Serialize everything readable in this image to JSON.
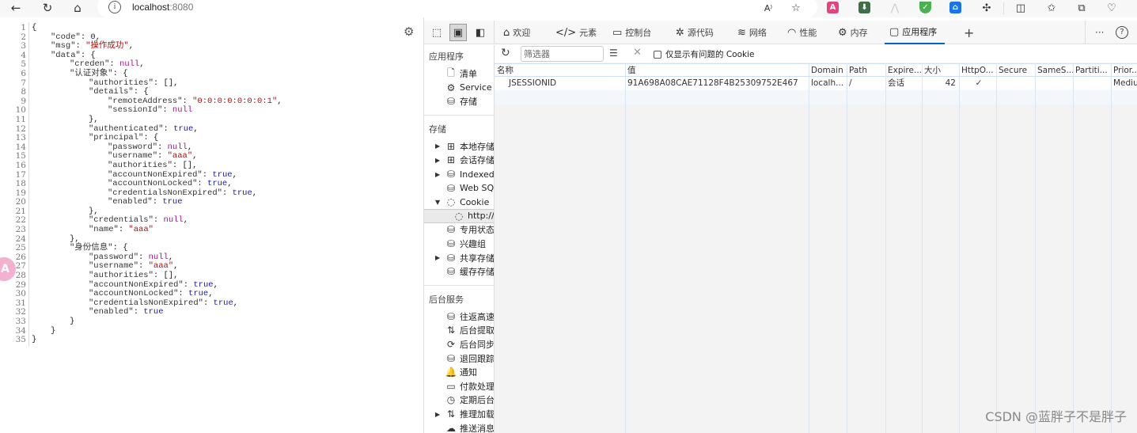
{
  "browser": {
    "url_host": "localhost",
    "url_port": ":8080",
    "icons": [
      "back-icon",
      "refresh-icon",
      "home-icon",
      "info-icon",
      "read-aloud-icon",
      "favorite-star-icon",
      "translate-extension-icon",
      "download-extension-icon",
      "extension-icon",
      "shield-extension-icon",
      "extension-icon",
      "puzzle-extensions-icon",
      "split-screen-icon",
      "favorites-list-icon",
      "collections-icon",
      "browser-health-icon"
    ]
  },
  "json_viewer": {
    "line_numbers": [
      "1",
      "2",
      "3",
      "4",
      "5",
      "6",
      "7",
      "8",
      "9",
      "10",
      "11",
      "12",
      "13",
      "14",
      "15",
      "16",
      "17",
      "18",
      "19",
      "20",
      "21",
      "22",
      "23",
      "24",
      "25",
      "26",
      "27",
      "28",
      "29",
      "30",
      "31",
      "32",
      "33",
      "34",
      "35"
    ],
    "lines": [
      {
        "indent": 0,
        "parts": [
          [
            "p",
            "{"
          ]
        ]
      },
      {
        "indent": 1,
        "parts": [
          [
            "k",
            "\"code\""
          ],
          [
            "p",
            ": "
          ],
          [
            "n",
            "0"
          ],
          [
            "p",
            ","
          ]
        ]
      },
      {
        "indent": 1,
        "parts": [
          [
            "k",
            "\"msg\""
          ],
          [
            "p",
            ": "
          ],
          [
            "s",
            "\"操作成功\""
          ],
          [
            "p",
            ","
          ]
        ]
      },
      {
        "indent": 1,
        "parts": [
          [
            "k",
            "\"data\""
          ],
          [
            "p",
            ": {"
          ]
        ]
      },
      {
        "indent": 2,
        "parts": [
          [
            "k",
            "\"creden\""
          ],
          [
            "p",
            ": "
          ],
          [
            "nul",
            "null"
          ],
          [
            "p",
            ","
          ]
        ]
      },
      {
        "indent": 2,
        "parts": [
          [
            "k",
            "\"认证对象\""
          ],
          [
            "p",
            ": {"
          ]
        ]
      },
      {
        "indent": 3,
        "parts": [
          [
            "k",
            "\"authorities\""
          ],
          [
            "p",
            ": [],"
          ]
        ]
      },
      {
        "indent": 3,
        "parts": [
          [
            "k",
            "\"details\""
          ],
          [
            "p",
            ": {"
          ]
        ]
      },
      {
        "indent": 4,
        "parts": [
          [
            "k",
            "\"remoteAddress\""
          ],
          [
            "p",
            ": "
          ],
          [
            "s",
            "\"0:0:0:0:0:0:0:1\""
          ],
          [
            "p",
            ","
          ]
        ]
      },
      {
        "indent": 4,
        "parts": [
          [
            "k",
            "\"sessionId\""
          ],
          [
            "p",
            ": "
          ],
          [
            "nul",
            "null"
          ]
        ]
      },
      {
        "indent": 3,
        "parts": [
          [
            "p",
            "},"
          ]
        ]
      },
      {
        "indent": 3,
        "parts": [
          [
            "k",
            "\"authenticated\""
          ],
          [
            "p",
            ": "
          ],
          [
            "b",
            "true"
          ],
          [
            "p",
            ","
          ]
        ]
      },
      {
        "indent": 3,
        "parts": [
          [
            "k",
            "\"principal\""
          ],
          [
            "p",
            ": {"
          ]
        ]
      },
      {
        "indent": 4,
        "parts": [
          [
            "k",
            "\"password\""
          ],
          [
            "p",
            ": "
          ],
          [
            "nul",
            "null"
          ],
          [
            "p",
            ","
          ]
        ]
      },
      {
        "indent": 4,
        "parts": [
          [
            "k",
            "\"username\""
          ],
          [
            "p",
            ": "
          ],
          [
            "s",
            "\"aaa\""
          ],
          [
            "p",
            ","
          ]
        ]
      },
      {
        "indent": 4,
        "parts": [
          [
            "k",
            "\"authorities\""
          ],
          [
            "p",
            ": [],"
          ]
        ]
      },
      {
        "indent": 4,
        "parts": [
          [
            "k",
            "\"accountNonExpired\""
          ],
          [
            "p",
            ": "
          ],
          [
            "b",
            "true"
          ],
          [
            "p",
            ","
          ]
        ]
      },
      {
        "indent": 4,
        "parts": [
          [
            "k",
            "\"accountNonLocked\""
          ],
          [
            "p",
            ": "
          ],
          [
            "b",
            "true"
          ],
          [
            "p",
            ","
          ]
        ]
      },
      {
        "indent": 4,
        "parts": [
          [
            "k",
            "\"credentialsNonExpired\""
          ],
          [
            "p",
            ": "
          ],
          [
            "b",
            "true"
          ],
          [
            "p",
            ","
          ]
        ]
      },
      {
        "indent": 4,
        "parts": [
          [
            "k",
            "\"enabled\""
          ],
          [
            "p",
            ": "
          ],
          [
            "b",
            "true"
          ]
        ]
      },
      {
        "indent": 3,
        "parts": [
          [
            "p",
            "},"
          ]
        ]
      },
      {
        "indent": 3,
        "parts": [
          [
            "k",
            "\"credentials\""
          ],
          [
            "p",
            ": "
          ],
          [
            "nul",
            "null"
          ],
          [
            "p",
            ","
          ]
        ]
      },
      {
        "indent": 3,
        "parts": [
          [
            "k",
            "\"name\""
          ],
          [
            "p",
            ": "
          ],
          [
            "s",
            "\"aaa\""
          ]
        ]
      },
      {
        "indent": 2,
        "parts": [
          [
            "p",
            "},"
          ]
        ]
      },
      {
        "indent": 2,
        "parts": [
          [
            "k",
            "\"身份信息\""
          ],
          [
            "p",
            ": {"
          ]
        ]
      },
      {
        "indent": 3,
        "parts": [
          [
            "k",
            "\"password\""
          ],
          [
            "p",
            ": "
          ],
          [
            "nul",
            "null"
          ],
          [
            "p",
            ","
          ]
        ]
      },
      {
        "indent": 3,
        "parts": [
          [
            "k",
            "\"username\""
          ],
          [
            "p",
            ": "
          ],
          [
            "s",
            "\"aaa\""
          ],
          [
            "p",
            ","
          ]
        ]
      },
      {
        "indent": 3,
        "parts": [
          [
            "k",
            "\"authorities\""
          ],
          [
            "p",
            ": [],"
          ]
        ]
      },
      {
        "indent": 3,
        "parts": [
          [
            "k",
            "\"accountNonExpired\""
          ],
          [
            "p",
            ": "
          ],
          [
            "b",
            "true"
          ],
          [
            "p",
            ","
          ]
        ]
      },
      {
        "indent": 3,
        "parts": [
          [
            "k",
            "\"accountNonLocked\""
          ],
          [
            "p",
            ": "
          ],
          [
            "b",
            "true"
          ],
          [
            "p",
            ","
          ]
        ]
      },
      {
        "indent": 3,
        "parts": [
          [
            "k",
            "\"credentialsNonExpired\""
          ],
          [
            "p",
            ": "
          ],
          [
            "b",
            "true"
          ],
          [
            "p",
            ","
          ]
        ]
      },
      {
        "indent": 3,
        "parts": [
          [
            "k",
            "\"enabled\""
          ],
          [
            "p",
            ": "
          ],
          [
            "b",
            "true"
          ]
        ]
      },
      {
        "indent": 2,
        "parts": [
          [
            "p",
            "}"
          ]
        ]
      },
      {
        "indent": 1,
        "parts": [
          [
            "p",
            "}"
          ]
        ]
      },
      {
        "indent": 0,
        "parts": [
          [
            "p",
            "}"
          ]
        ]
      }
    ],
    "translate_badge": "A"
  },
  "devtools": {
    "tabs": [
      {
        "label": "欢迎",
        "icon": "⌂",
        "icon_name": "home-icon"
      },
      {
        "label": "元素",
        "icon": "</>",
        "icon_name": "elements-code-icon"
      },
      {
        "label": "控制台",
        "icon": "▭",
        "icon_name": "console-icon"
      },
      {
        "label": "源代码",
        "icon": "✲",
        "icon_name": "sources-bug-icon"
      },
      {
        "label": "网络",
        "icon": "≋",
        "icon_name": "network-wifi-icon"
      },
      {
        "label": "性能",
        "icon": "◠",
        "icon_name": "performance-gauge-icon"
      },
      {
        "label": "内存",
        "icon": "⚙",
        "icon_name": "memory-chip-icon"
      },
      {
        "label": "应用程序",
        "icon": "▢",
        "icon_name": "application-window-icon",
        "active": true
      }
    ],
    "add_tab": "+",
    "more": "···",
    "help": "?",
    "sidebar": {
      "sections": [
        {
          "title": "应用程序",
          "items": [
            {
              "label": "清单",
              "icon": "🗋",
              "icon_name": "manifest-file-icon",
              "arrow": ""
            },
            {
              "label": "Service w",
              "icon": "⚙",
              "icon_name": "service-worker-icon",
              "arrow": ""
            },
            {
              "label": "存储",
              "icon": "⛁",
              "icon_name": "storage-cylinder-icon",
              "arrow": ""
            }
          ]
        },
        {
          "title": "存储",
          "items": [
            {
              "label": "本地存储",
              "icon": "⊞",
              "icon_name": "local-storage-grid-icon",
              "arrow": "▶"
            },
            {
              "label": "会话存储",
              "icon": "⊞",
              "icon_name": "session-storage-grid-icon",
              "arrow": "▶"
            },
            {
              "label": "IndexedD",
              "icon": "⛁",
              "icon_name": "indexeddb-cylinder-icon",
              "arrow": "▶"
            },
            {
              "label": "Web SQL",
              "icon": "⛁",
              "icon_name": "websql-cylinder-icon",
              "arrow": ""
            },
            {
              "label": "Cookie",
              "icon": "◌",
              "icon_name": "cookie-icon",
              "arrow": "▼"
            },
            {
              "label": "http://",
              "icon": "◌",
              "icon_name": "cookie-icon",
              "arrow": "",
              "selected": true,
              "sub": true
            },
            {
              "label": "专用状态",
              "icon": "⛁",
              "icon_name": "private-state-cylinder-icon",
              "arrow": ""
            },
            {
              "label": "兴趣组",
              "icon": "⛁",
              "icon_name": "interest-group-cylinder-icon",
              "arrow": ""
            },
            {
              "label": "共享存储",
              "icon": "⛁",
              "icon_name": "shared-storage-cylinder-icon",
              "arrow": "▶"
            },
            {
              "label": "缓存存储",
              "icon": "⛁",
              "icon_name": "cache-storage-cylinder-icon",
              "arrow": ""
            }
          ]
        },
        {
          "title": "后台服务",
          "items": [
            {
              "label": "往返高速",
              "icon": "⛁",
              "icon_name": "bfcache-cylinder-icon",
              "arrow": ""
            },
            {
              "label": "后台提取",
              "icon": "⇅",
              "icon_name": "background-fetch-arrows-icon",
              "arrow": ""
            },
            {
              "label": "后台同步",
              "icon": "⟳",
              "icon_name": "background-sync-icon",
              "arrow": ""
            },
            {
              "label": "退回跟踪",
              "icon": "⛁",
              "icon_name": "bounce-tracking-cylinder-icon",
              "arrow": ""
            },
            {
              "label": "通知",
              "icon": "🔔",
              "icon_name": "notification-bell-icon",
              "arrow": ""
            },
            {
              "label": "付款处理",
              "icon": "▭",
              "icon_name": "payment-card-icon",
              "arrow": ""
            },
            {
              "label": "定期后台",
              "icon": "◷",
              "icon_name": "periodic-sync-clock-icon",
              "arrow": ""
            },
            {
              "label": "推理加载",
              "icon": "⇅",
              "icon_name": "speculative-loads-arrows-icon",
              "arrow": "▶"
            },
            {
              "label": "推送消息",
              "icon": "☁",
              "icon_name": "push-messaging-cloud-icon",
              "arrow": ""
            }
          ]
        }
      ]
    },
    "cookies": {
      "filter_placeholder": "筛选器",
      "filter_value": "",
      "only_issues_label": "仅显示有问题的 Cookie",
      "only_issues_checked": false,
      "columns": [
        "名称",
        "值",
        "Domain",
        "Path",
        "Expire...",
        "大小",
        "HttpO...",
        "Secure",
        "SameS...",
        "Partiti...",
        "Prior..."
      ],
      "rows": [
        [
          "JSESSIONID",
          "91A698A08CAE71128F4B25309752E467",
          "localh...",
          "/",
          "会话",
          "42",
          "✓",
          "",
          "",
          "",
          "Mediu"
        ]
      ]
    }
  },
  "watermark": "CSDN @蓝胖子不是胖子"
}
